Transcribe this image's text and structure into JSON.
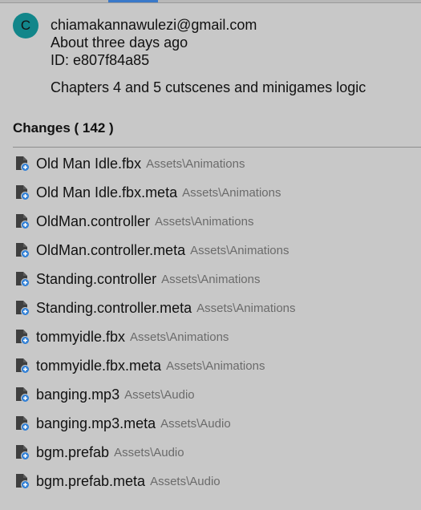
{
  "commit": {
    "avatar_letter": "C",
    "avatar_color": "#12868a",
    "author": "chiamakannawulezi@gmail.com",
    "time": "About three days ago",
    "id_label": "ID:",
    "id_value": "e807f84a85",
    "message": "Chapters 4 and 5 cutscenes and minigames logic"
  },
  "changes": {
    "label": "Changes",
    "count_text": "( 142 )",
    "files": [
      {
        "name": "Old Man Idle.fbx",
        "path": "Assets\\Animations",
        "icon": "file-added-icon"
      },
      {
        "name": "Old Man Idle.fbx.meta",
        "path": "Assets\\Animations",
        "icon": "file-added-icon"
      },
      {
        "name": "OldMan.controller",
        "path": "Assets\\Animations",
        "icon": "file-added-icon"
      },
      {
        "name": "OldMan.controller.meta",
        "path": "Assets\\Animations",
        "icon": "file-added-icon"
      },
      {
        "name": "Standing.controller",
        "path": "Assets\\Animations",
        "icon": "file-added-icon"
      },
      {
        "name": "Standing.controller.meta",
        "path": "Assets\\Animations",
        "icon": "file-added-icon"
      },
      {
        "name": "tommyidle.fbx",
        "path": "Assets\\Animations",
        "icon": "file-added-icon"
      },
      {
        "name": "tommyidle.fbx.meta",
        "path": "Assets\\Animations",
        "icon": "file-added-icon"
      },
      {
        "name": "banging.mp3",
        "path": "Assets\\Audio",
        "icon": "file-added-icon"
      },
      {
        "name": "banging.mp3.meta",
        "path": "Assets\\Audio",
        "icon": "file-added-icon"
      },
      {
        "name": "bgm.prefab",
        "path": "Assets\\Audio",
        "icon": "file-added-icon"
      },
      {
        "name": "bgm.prefab.meta",
        "path": "Assets\\Audio",
        "icon": "file-added-icon"
      }
    ]
  },
  "colors": {
    "background": "#c8c8c8",
    "accent": "#3a79c9",
    "path_text": "#6b6b6b",
    "added_badge": "#2f7fd6"
  }
}
